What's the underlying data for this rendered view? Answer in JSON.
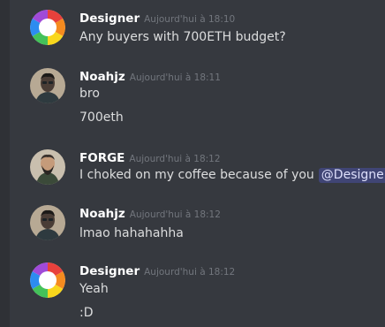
{
  "messages": [
    {
      "author": "Designer",
      "timestamp": "Aujourd'hui à 18:10",
      "avatar_icon": "color-wheel-icon",
      "lines": [
        "Any buyers with 700ETH budget?"
      ]
    },
    {
      "author": "Noahjz",
      "timestamp": "Aujourd'hui à 18:11",
      "avatar_icon": "noahjz-avatar",
      "lines": [
        "bro",
        "700eth"
      ]
    },
    {
      "author": "FORGE",
      "timestamp": "Aujourd'hui à 18:12",
      "avatar_icon": "forge-avatar",
      "lines": [
        "I choked on my coffee because of you"
      ],
      "mention": "@Designer"
    },
    {
      "author": "Noahjz",
      "timestamp": "Aujourd'hui à 18:12",
      "avatar_icon": "noahjz-avatar",
      "lines": [
        "lmao hahahahha"
      ]
    },
    {
      "author": "Designer",
      "timestamp": "Aujourd'hui à 18:12",
      "avatar_icon": "color-wheel-icon",
      "lines": [
        "Yeah",
        ":D"
      ]
    }
  ],
  "colors": {
    "background": "#36393f",
    "username": "#ffffff",
    "timestamp": "#72767d",
    "message_text": "#dcddde",
    "mention_bg": "rgba(88,101,242,0.3)",
    "mention_text": "#dee0fc"
  }
}
